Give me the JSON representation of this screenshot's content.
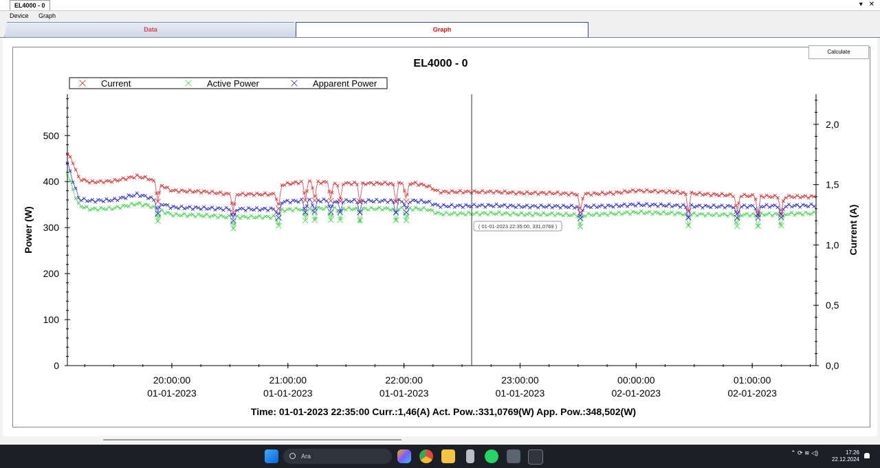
{
  "window": {
    "doc_tab": "EL4000 - 0",
    "controls": [
      "▾",
      "✕"
    ]
  },
  "menu": [
    "Device",
    "Graph"
  ],
  "tabs": {
    "data": "Data",
    "graph": "Graph"
  },
  "calculate_label": "Calculate",
  "status_line": "Time: 01-01-2023 22:35:00 Curr.:1,46(A) Act. Pow.:331,0769(W) App. Pow.:348,502(W)",
  "cursor_tooltip": "( 01-01-2023 22:35:00, 331,0769 )",
  "taskbar": {
    "search_placeholder": "Ara",
    "time": "17:26",
    "date": "22.12.2024"
  },
  "chart_data": {
    "type": "scatter",
    "title": "EL4000 - 0",
    "ylabel": "Power (W)",
    "y2label": "Current (A)",
    "ylim": [
      0,
      590
    ],
    "y2lim": [
      0,
      2.25
    ],
    "yticks": [
      "0",
      "100",
      "200",
      "300",
      "400",
      "500"
    ],
    "y2ticks": [
      "0,0",
      "0,5",
      "1,0",
      "1,5",
      "2,0"
    ],
    "xlim_hours": [
      19.1,
      25.55
    ],
    "xticks": [
      {
        "time": "20:00:00",
        "date": "01-01-2023",
        "h": 20
      },
      {
        "time": "21:00:00",
        "date": "01-01-2023",
        "h": 21
      },
      {
        "time": "22:00:00",
        "date": "01-01-2023",
        "h": 22
      },
      {
        "time": "23:00:00",
        "date": "01-01-2023",
        "h": 23
      },
      {
        "time": "00:00:00",
        "date": "02-01-2023",
        "h": 24
      },
      {
        "time": "01:00:00",
        "date": "02-01-2023",
        "h": 25
      }
    ],
    "cursor_h": 22.583,
    "legend_position": "top-left",
    "series": [
      {
        "name": "Current",
        "color": "#e02020",
        "axis": "y2",
        "x": [
          19.1,
          19.15,
          19.2,
          19.3,
          19.5,
          19.7,
          19.8,
          19.9,
          20.0,
          20.3,
          20.5,
          20.7,
          20.9,
          20.95,
          21.1,
          21.3,
          21.5,
          21.7,
          21.9,
          22.1,
          22.2,
          22.3,
          22.5,
          22.8,
          23.0,
          23.3,
          23.5,
          23.8,
          24.0,
          24.3,
          24.6,
          24.9,
          25.2,
          25.55
        ],
        "y": [
          1.76,
          1.68,
          1.55,
          1.52,
          1.53,
          1.57,
          1.55,
          1.5,
          1.45,
          1.44,
          1.42,
          1.42,
          1.42,
          1.5,
          1.52,
          1.52,
          1.51,
          1.51,
          1.51,
          1.51,
          1.49,
          1.44,
          1.44,
          1.44,
          1.43,
          1.43,
          1.42,
          1.43,
          1.45,
          1.44,
          1.42,
          1.41,
          1.4,
          1.4
        ],
        "dips": [
          19.88,
          20.53,
          20.92,
          21.15,
          21.23,
          21.37,
          21.45,
          21.62,
          21.93,
          22.02,
          23.52,
          24.45,
          24.87,
          25.05,
          25.25
        ]
      },
      {
        "name": "Active Power",
        "color": "#2fd63a",
        "axis": "y",
        "x": [
          19.1,
          19.15,
          19.2,
          19.3,
          19.5,
          19.7,
          19.8,
          19.9,
          20.0,
          20.3,
          20.5,
          20.7,
          20.9,
          20.95,
          21.1,
          21.3,
          21.5,
          21.7,
          21.9,
          22.1,
          22.2,
          22.3,
          22.5,
          22.8,
          23.0,
          23.3,
          23.5,
          23.8,
          24.0,
          24.3,
          24.6,
          24.9,
          25.2,
          25.55
        ],
        "y": [
          420,
          380,
          348,
          340,
          342,
          352,
          348,
          337,
          328,
          326,
          323,
          323,
          323,
          338,
          340,
          342,
          341,
          341,
          341,
          341,
          340,
          330,
          330,
          331,
          329,
          329,
          327,
          330,
          333,
          331,
          328,
          328,
          329,
          331
        ],
        "dips": [
          19.88,
          20.53,
          20.92,
          21.15,
          21.23,
          21.37,
          21.45,
          21.62,
          21.93,
          22.02,
          23.52,
          24.45,
          24.87,
          25.05,
          25.25
        ]
      },
      {
        "name": "Apparent Power",
        "color": "#2020d8",
        "axis": "y",
        "x": [
          19.1,
          19.15,
          19.2,
          19.3,
          19.5,
          19.7,
          19.8,
          19.9,
          20.0,
          20.3,
          20.5,
          20.7,
          20.9,
          20.95,
          21.1,
          21.3,
          21.5,
          21.7,
          21.9,
          22.1,
          22.2,
          22.3,
          22.5,
          22.8,
          23.0,
          23.3,
          23.5,
          23.8,
          24.0,
          24.3,
          24.6,
          24.9,
          25.2,
          25.55
        ],
        "y": [
          440,
          400,
          362,
          358,
          360,
          372,
          366,
          353,
          344,
          342,
          340,
          340,
          340,
          356,
          358,
          359,
          358,
          358,
          358,
          358,
          356,
          347,
          347,
          348,
          346,
          346,
          345,
          347,
          350,
          348,
          346,
          346,
          347,
          348
        ],
        "dips": [
          19.88,
          20.53,
          20.92,
          21.15,
          21.23,
          21.37,
          21.45,
          21.62,
          21.93,
          22.02,
          23.52,
          24.45,
          24.87,
          25.05,
          25.25
        ]
      }
    ]
  }
}
